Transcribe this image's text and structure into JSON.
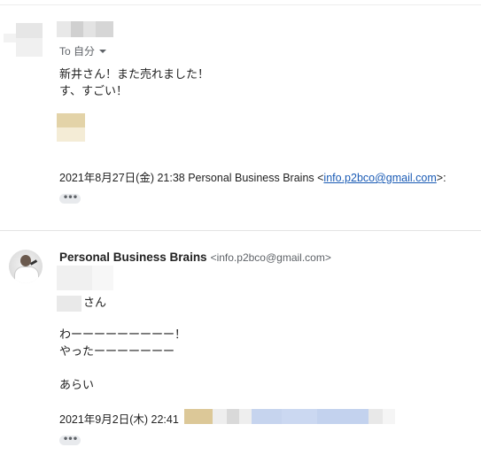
{
  "message1": {
    "to_label": "To 自分",
    "body_lines": [
      "新井さん！また売れました！",
      "す、すごい！"
    ],
    "quote_header_prefix": "2021年8月27日(金) 21:38 Personal Business Brains <",
    "quote_header_email": "info.p2bco@gmail.com",
    "quote_header_suffix": ">:",
    "ellipsis": "•••"
  },
  "message2": {
    "sender_name": "Personal Business Brains",
    "sender_email": "<info.p2bco@gmail.com>",
    "greeting_suffix": "さん",
    "body_lines": [
      "わーーーーーーーーー！",
      "やったーーーーーーー"
    ],
    "closing": "あらい",
    "date_line": "2021年9月2日(木) 22:41",
    "ellipsis": "•••"
  },
  "icons": {
    "caret": "chevron-down-icon",
    "avatar": "sender-avatar"
  }
}
